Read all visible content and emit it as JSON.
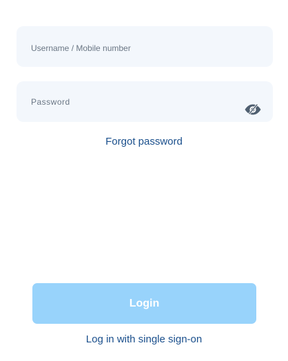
{
  "login_form": {
    "username": {
      "value": "",
      "placeholder": "Username / Mobile number"
    },
    "password": {
      "value": "",
      "placeholder": "Password",
      "visibility_icon": "eye-slash-icon"
    },
    "forgot_password_label": "Forgot password",
    "login_button_label": "Login",
    "sso_link_label": "Log in with single sign-on"
  },
  "colors": {
    "field_background": "#f3f7fc",
    "link": "#1a4f8c",
    "login_button": "#98d3fb",
    "login_button_text": "#ffffff",
    "icon": "#4f5f70"
  }
}
